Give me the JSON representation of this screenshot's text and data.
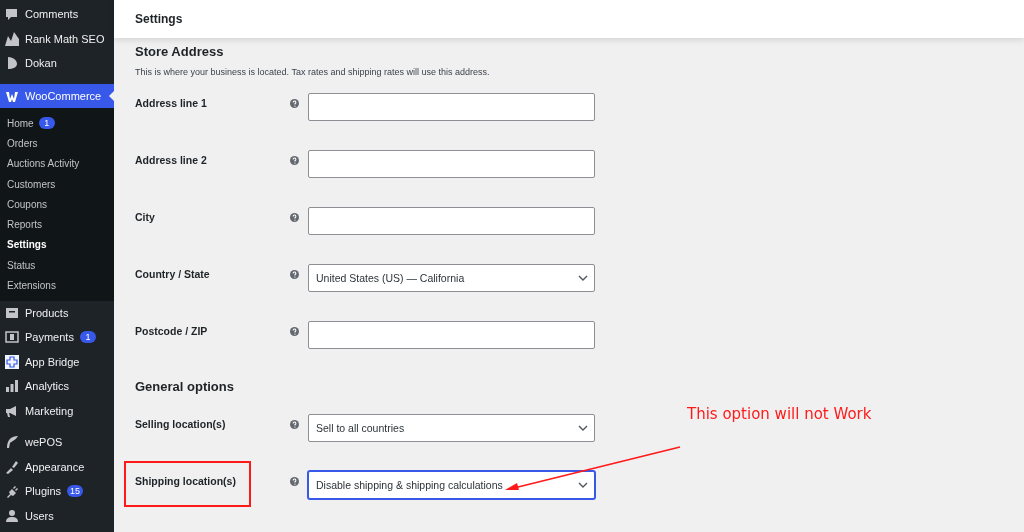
{
  "sidebar": {
    "items": [
      {
        "label": "Comments",
        "selected": false
      },
      {
        "label": "Rank Math SEO",
        "selected": false
      },
      {
        "label": "Dokan",
        "selected": false
      },
      {
        "label": "WooCommerce",
        "selected": true,
        "children": [
          {
            "label": "Home",
            "selected": false,
            "badge": "1"
          },
          {
            "label": "Orders",
            "selected": false
          },
          {
            "label": "Auctions Activity",
            "selected": false
          },
          {
            "label": "Customers",
            "selected": false
          },
          {
            "label": "Coupons",
            "selected": false
          },
          {
            "label": "Reports",
            "selected": false
          },
          {
            "label": "Settings",
            "selected": true
          },
          {
            "label": "Status",
            "selected": false
          },
          {
            "label": "Extensions",
            "selected": false
          }
        ]
      },
      {
        "label": "Products",
        "selected": false
      },
      {
        "label": "Payments",
        "selected": false,
        "badge": "1"
      },
      {
        "label": "App Bridge",
        "selected": false
      },
      {
        "label": "Analytics",
        "selected": false
      },
      {
        "label": "Marketing",
        "selected": false
      },
      {
        "label": "wePOS",
        "selected": false,
        "separated": true
      },
      {
        "label": "Appearance",
        "selected": false
      },
      {
        "label": "Plugins",
        "selected": false,
        "badge": "15"
      },
      {
        "label": "Users",
        "selected": false
      }
    ]
  },
  "header": {
    "title": "Settings"
  },
  "sections": [
    {
      "title": "Store Address",
      "description": "This is where your business is located. Tax rates and shipping rates will use this address.",
      "fields": [
        {
          "label": "Address line 1",
          "kind": "text"
        },
        {
          "label": "Address line 2",
          "kind": "text"
        },
        {
          "label": "City",
          "kind": "text"
        },
        {
          "label": "Country / State",
          "kind": "select",
          "value": "United States (US) — California",
          "focused": false
        },
        {
          "label": "Postcode / ZIP",
          "kind": "text"
        }
      ]
    },
    {
      "title": "General options",
      "fields": [
        {
          "label": "Selling location(s)",
          "kind": "select",
          "value": "Sell to all countries",
          "focused": false
        },
        {
          "label": "Shipping location(s)",
          "kind": "select",
          "value": "Disable shipping & shipping calculations",
          "focused": true
        }
      ]
    }
  ],
  "annotation": {
    "text": "This option will not Work"
  }
}
